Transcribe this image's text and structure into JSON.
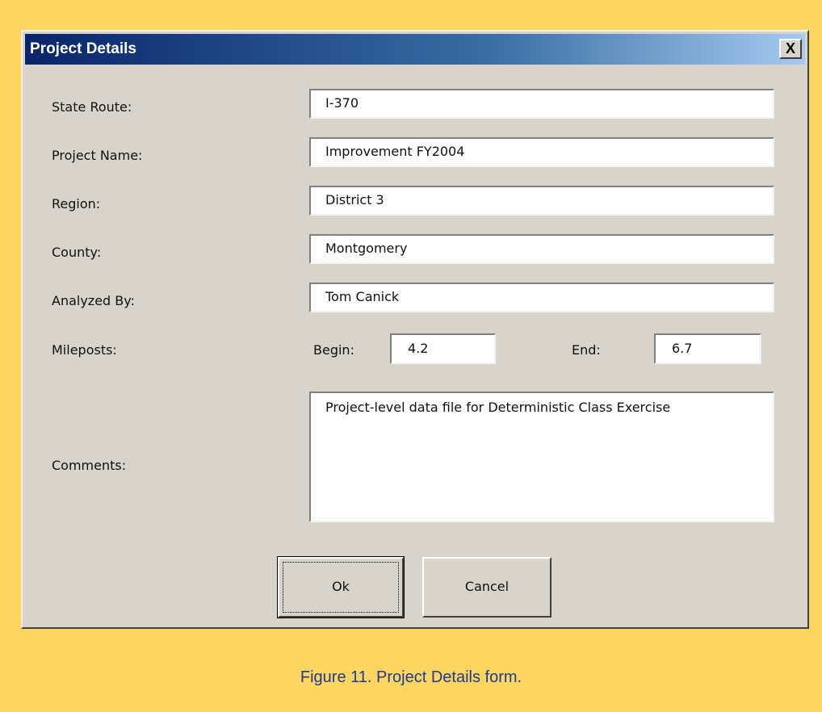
{
  "window": {
    "title": "Project Details",
    "close_label": "X"
  },
  "form": {
    "fields": [
      {
        "label": "State Route:",
        "value": "I-370"
      },
      {
        "label": "Project Name:",
        "value": "Improvement FY2004"
      },
      {
        "label": "Region:",
        "value": "District 3"
      },
      {
        "label": "County:",
        "value": "Montgomery"
      },
      {
        "label": "Analyzed By:",
        "value": "Tom Canick"
      }
    ],
    "mileposts": {
      "label": "Mileposts:",
      "begin_label": "Begin:",
      "begin_value": "4.2",
      "end_label": "End:",
      "end_value": "6.7"
    },
    "comments": {
      "label": "Comments:",
      "value": "Project-level data file for Deterministic Class Exercise"
    }
  },
  "buttons": {
    "ok": "Ok",
    "cancel": "Cancel"
  },
  "caption": {
    "prefix": "Figure 11.",
    "text": "Project Details form."
  },
  "colors": {
    "page_background": "#fcd660",
    "dialog_background": "#d8d4cc",
    "titlebar_start": "#0a246a",
    "caption": "#1f3a93"
  }
}
